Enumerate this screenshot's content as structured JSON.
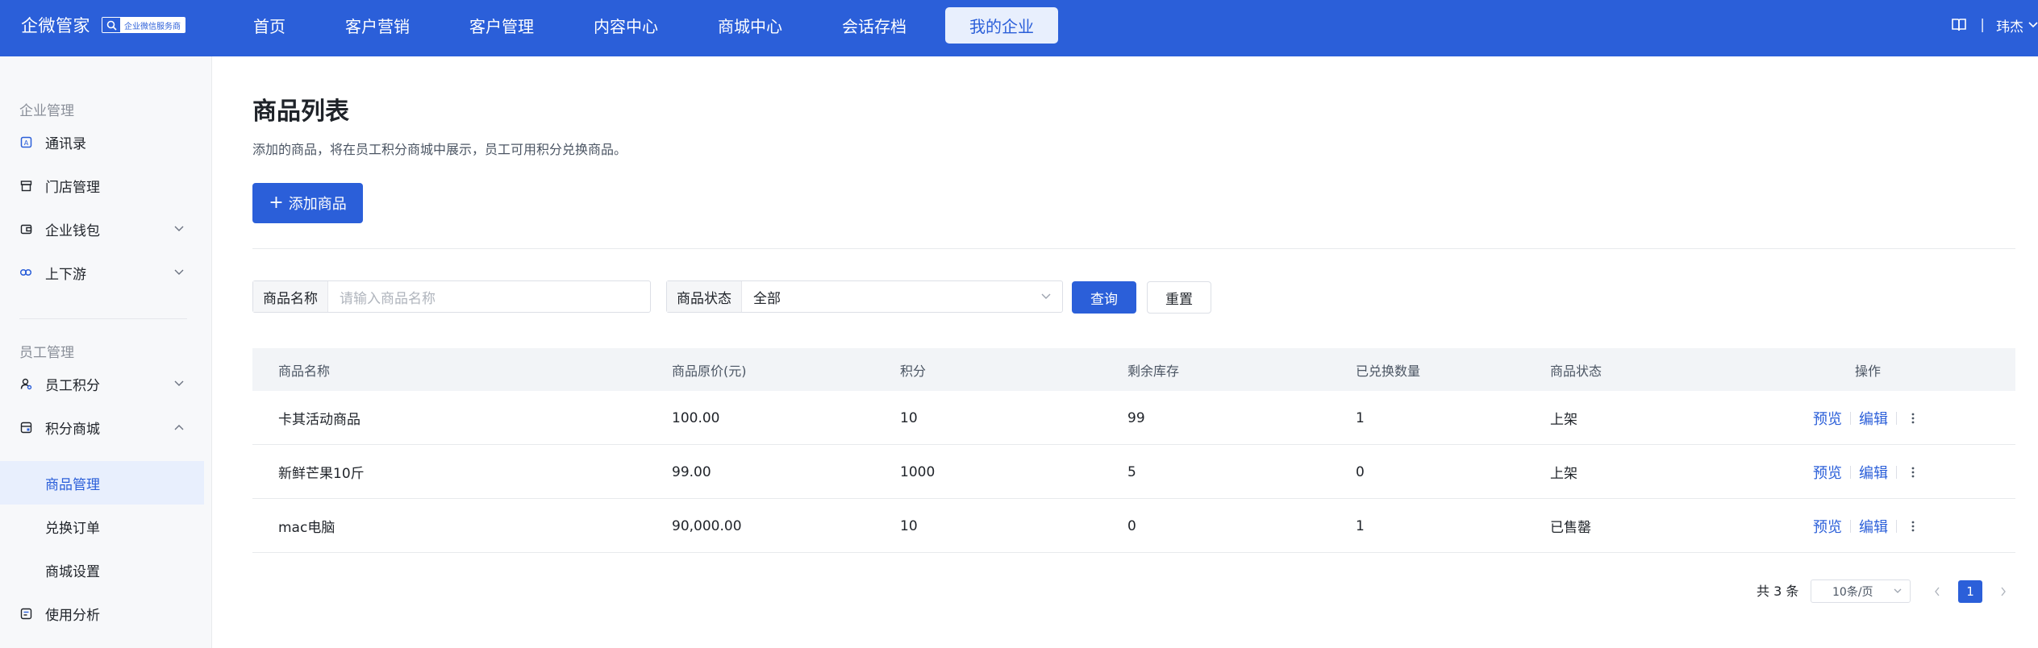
{
  "brand": {
    "title": "企微管家",
    "badge": "企业微信服务商"
  },
  "topnav": [
    {
      "label": "首页"
    },
    {
      "label": "客户营销"
    },
    {
      "label": "客户管理"
    },
    {
      "label": "内容中心"
    },
    {
      "label": "商城中心"
    },
    {
      "label": "会话存档"
    },
    {
      "label": "我的企业",
      "active": true
    }
  ],
  "user": {
    "name": "玮杰"
  },
  "sidebar": {
    "group1": "企业管理",
    "group2": "员工管理",
    "items": [
      {
        "label": "通讯录",
        "icon": "contacts-icon"
      },
      {
        "label": "门店管理",
        "icon": "store-icon"
      },
      {
        "label": "企业钱包",
        "icon": "wallet-icon"
      },
      {
        "label": "上下游",
        "icon": "link-icon"
      },
      {
        "label": "员工积分",
        "icon": "user-points-icon"
      },
      {
        "label": "积分商城",
        "icon": "mall-icon"
      },
      {
        "label": "商品管理"
      },
      {
        "label": "兑换订单"
      },
      {
        "label": "商城设置"
      },
      {
        "label": "使用分析",
        "icon": "analysis-icon"
      }
    ]
  },
  "page": {
    "title": "商品列表",
    "description": "添加的商品，将在员工积分商城中展示，员工可用积分兑换商品。",
    "add_button": "添加商品"
  },
  "filters": {
    "name_label": "商品名称",
    "name_placeholder": "请输入商品名称",
    "status_label": "商品状态",
    "status_value": "全部",
    "query_button": "查询",
    "reset_button": "重置"
  },
  "table": {
    "columns": [
      "商品名称",
      "商品原价(元)",
      "积分",
      "剩余库存",
      "已兑换数量",
      "商品状态",
      "操作"
    ],
    "rows": [
      {
        "name": "卡其活动商品",
        "price": "100.00",
        "points": "10",
        "stock": "99",
        "redeemed": "1",
        "status": "上架"
      },
      {
        "name": "新鲜芒果10斤",
        "price": "99.00",
        "points": "1000",
        "stock": "5",
        "redeemed": "0",
        "status": "上架"
      },
      {
        "name": "mac电脑",
        "price": "90,000.00",
        "points": "10",
        "stock": "0",
        "redeemed": "1",
        "status": "已售罄"
      }
    ],
    "actions": {
      "preview": "预览",
      "edit": "编辑"
    }
  },
  "pagination": {
    "total": "共 3 条",
    "page_size": "10条/页",
    "current_page": "1"
  },
  "colors": {
    "primary": "#2b5fd9",
    "active_bg": "#e8effd"
  }
}
